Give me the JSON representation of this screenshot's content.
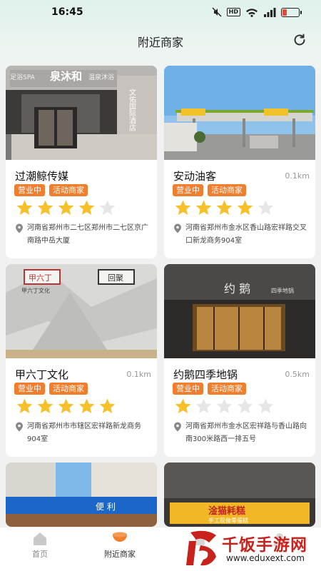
{
  "status": {
    "time": "16:45",
    "hd": "HD",
    "signal": "4G",
    "battery_level": 0.3
  },
  "header": {
    "title": "附近商家"
  },
  "merchants": [
    {
      "name": "过潮鲸传媒",
      "distance": "",
      "status_tag": "营业中",
      "promo_tag": "活动商家",
      "rating": 4,
      "address": "河南省郑州市二七区郑州市二七区京广南路中岳大厦"
    },
    {
      "name": "安动油客",
      "distance": "0.1km",
      "status_tag": "营业中",
      "promo_tag": "活动商家",
      "rating": 4,
      "address": "河南省郑州市金水区香山路宏祥路交叉口新龙商务904室"
    },
    {
      "name": "甲六丁文化",
      "distance": "0.1km",
      "status_tag": "营业中",
      "promo_tag": "活动商家",
      "rating": 5,
      "address": "河南省郑州市市辖区宏祥路新龙商务904室"
    },
    {
      "name": "约鹅四季地锅",
      "distance": "0.5km",
      "status_tag": "营业中",
      "promo_tag": "活动商家",
      "rating": 1,
      "address": "河南省郑州市金水区宏祥路与香山路向南300米路西一排五号"
    }
  ],
  "photo_signs": {
    "m1_top": "足浴SPA",
    "m1_brand": "泉沐和",
    "m1_sub": "温泉沐浴",
    "m1_side": "文佑国际酒店",
    "m3_left": "甲六丁",
    "m3_right": "回聚",
    "m3_sub": "甲六丁文化",
    "m4_sign": "约 鹅",
    "m4_sub": "四季地锅",
    "m6_sign": "淦猫耗糕",
    "m6_sub": "手工现做零蛋糕",
    "m5_sign": "便 利"
  },
  "tabs": [
    {
      "label": "首页",
      "icon": "home-icon"
    },
    {
      "label": "附近商家",
      "icon": "nearby-icon",
      "active": true
    },
    {
      "label": "",
      "icon": "orders-icon"
    },
    {
      "label": "",
      "icon": "profile-icon"
    }
  ],
  "watermark": {
    "text": "千饭手游网",
    "url": "www.eduxext.com"
  },
  "colors": {
    "accent": "#f07e2c",
    "star_on": "#f5c02a",
    "star_off": "#e6e6e6"
  }
}
